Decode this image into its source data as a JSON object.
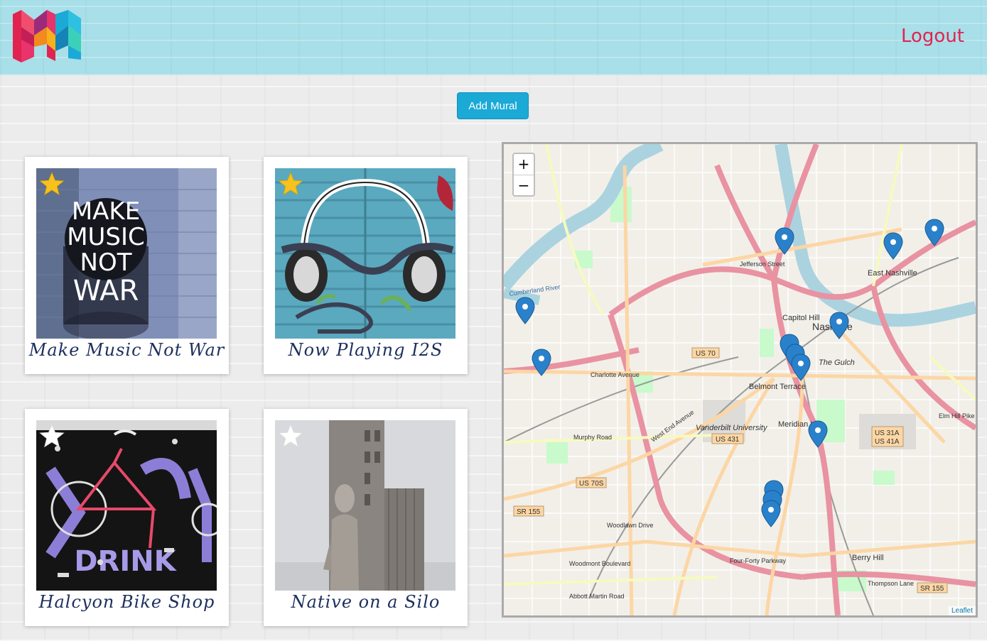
{
  "navbar": {
    "logout_label": "Logout"
  },
  "actions": {
    "add_mural_label": "Add Mural"
  },
  "murals": [
    {
      "title": "Make Music Not War",
      "favorite": true
    },
    {
      "title": "Now Playing I2S",
      "favorite": true
    },
    {
      "title": "Halcyon Bike Shop",
      "favorite": false
    },
    {
      "title": "Native on a Silo",
      "favorite": false
    }
  ],
  "mural_art": {
    "make_music": [
      "MAKE",
      "MUSIC",
      "NOT",
      "WAR"
    ],
    "halcyon": "DRINK"
  },
  "map": {
    "zoom_in": "+",
    "zoom_out": "−",
    "attribution": "Leaflet",
    "labels": {
      "east_nashville": "East Nashville",
      "nashville": "Nashville",
      "capitol_hill": "Capitol Hill",
      "the_gulch": "The Gulch",
      "belmont": "Belmont Terrace",
      "meridian": "Meridian Hill",
      "vanderbilt": "Vanderbilt University",
      "berry_hill": "Berry Hill",
      "us70": "US 70",
      "us70s": "US 70S",
      "us431": "US 431",
      "us31a": "US 31A",
      "us41a": "US 41A",
      "sr155": "SR 155",
      "sr155b": "SR 155",
      "charlotte": "Charlotte Avenue",
      "jefferson": "Jefferson Street",
      "murphy": "Murphy Road",
      "woodlawn": "Woodlawn Drive",
      "woodmont": "Woodmont Boulevard",
      "fourforty": "Four-Forty Parkway",
      "thompson": "Thompson Lane",
      "west_end": "West End Avenue",
      "cumberland": "Cumberland River",
      "abbott": "Abbott Martin Road",
      "elm_hill": "Elm Hill Pike"
    }
  },
  "colors": {
    "accent": "#1ba9d6",
    "logout": "#e0244f",
    "navbar": "#a8dfe8",
    "caption": "#1c2f5e",
    "star_filled": "#f6c21b",
    "marker": "#2a81cb"
  }
}
